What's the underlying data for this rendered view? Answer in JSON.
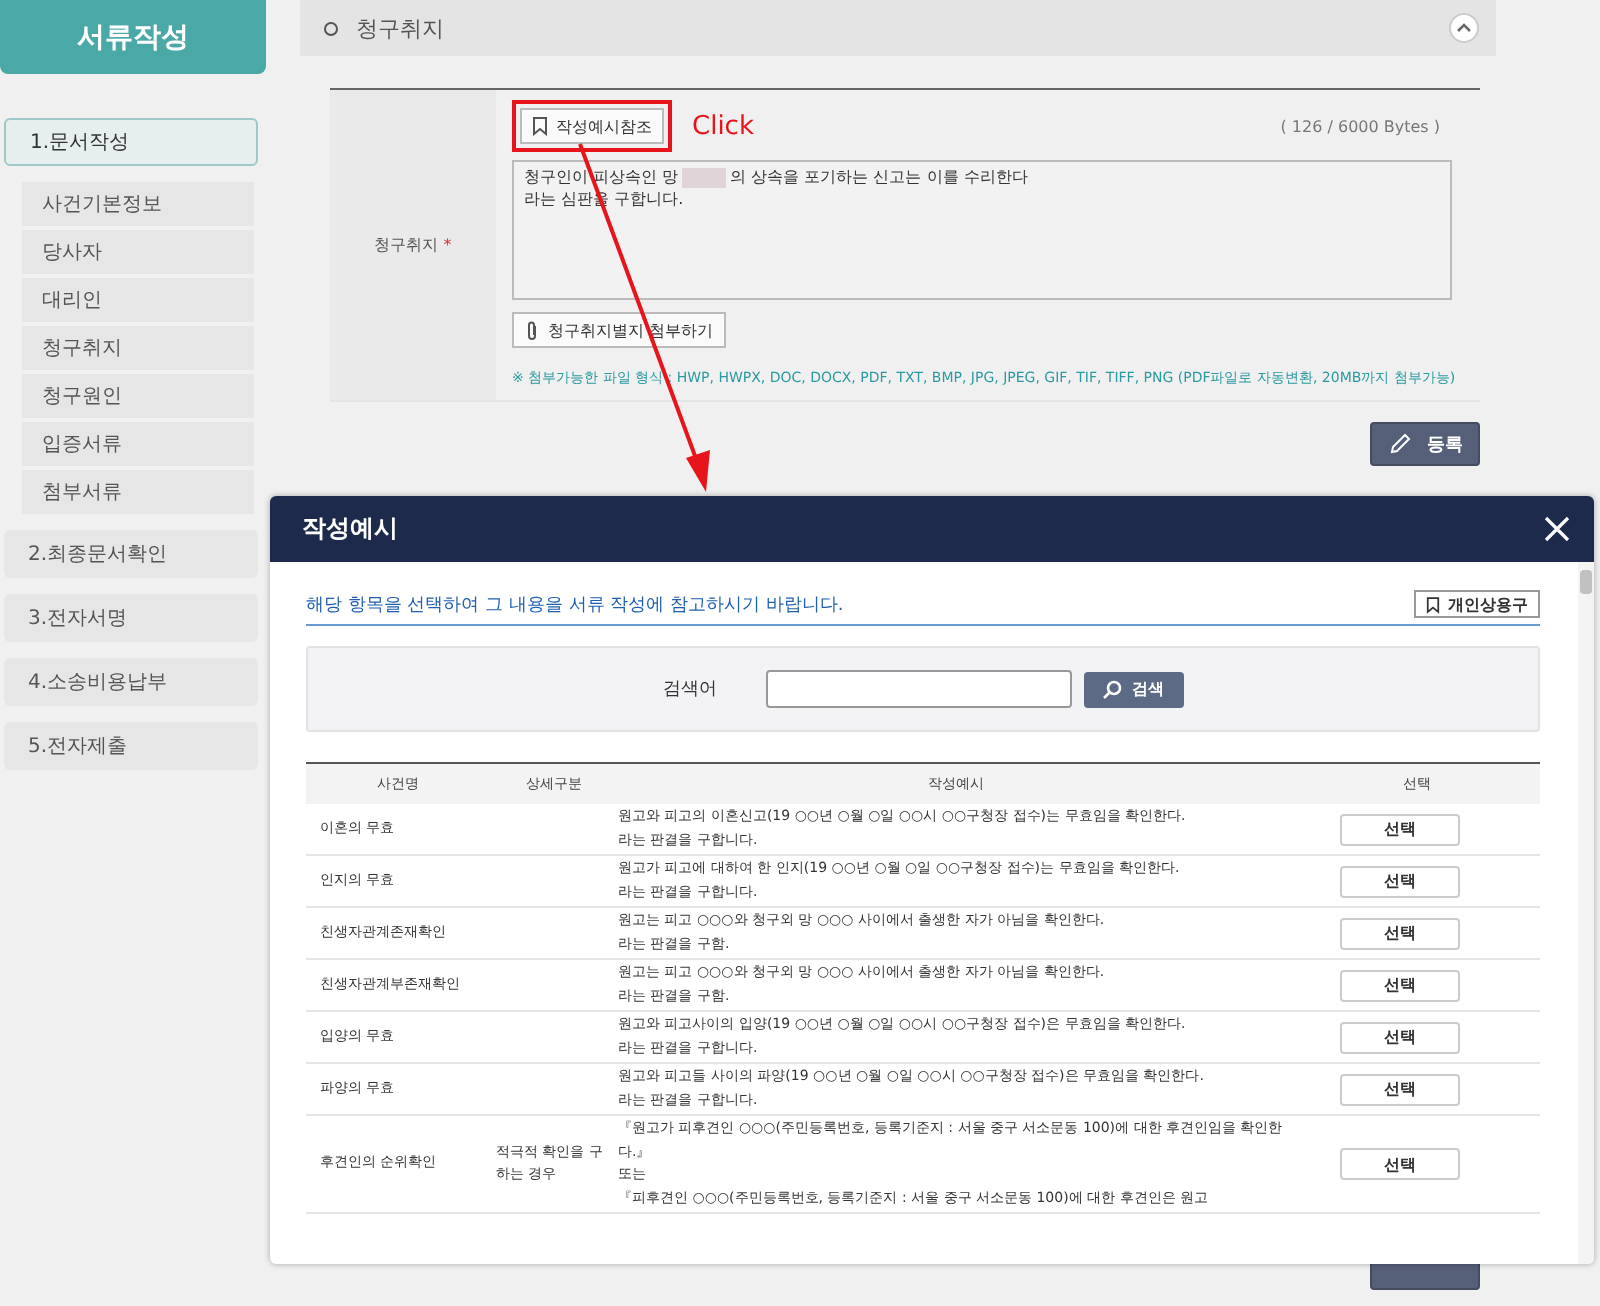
{
  "sidebar": {
    "title": "서류작성",
    "steps": [
      {
        "label": "1.문서작성",
        "selected": true,
        "children": [
          {
            "label": "사건기본정보"
          },
          {
            "label": "당사자"
          },
          {
            "label": "대리인"
          },
          {
            "label": "청구취지"
          },
          {
            "label": "청구원인"
          },
          {
            "label": "입증서류"
          },
          {
            "label": "첨부서류"
          }
        ]
      },
      {
        "label": "2.최종문서확인",
        "selected": false
      },
      {
        "label": "3.전자서명",
        "selected": false
      },
      {
        "label": "4.소송비용납부",
        "selected": false
      },
      {
        "label": "5.전자제출",
        "selected": false
      }
    ]
  },
  "section": {
    "title": "청구취지"
  },
  "form": {
    "label": "청구취지",
    "required_mark": "*",
    "example_button": "작성예시참조",
    "annotation": "Click",
    "byte_count": "( 126 / 6000 Bytes )",
    "text": {
      "before_redaction": "청구인이 피상속인 망",
      "after_redaction": "의 상속을 포기하는 신고는 이를 수리한다",
      "line_2": "라는 심판을 구합니다."
    },
    "attach_button": "청구취지별지 첨부하기",
    "file_note": "※ 첨부가능한 파일 형식 : HWP, HWPX, DOC, DOCX, PDF, TXT, BMP, JPG, JPEG, GIF, TIF, TIFF, PNG (PDF파일로 자동변환, 20MB까지 첨부가능)"
  },
  "register_button": "등록",
  "modal": {
    "title": "작성예시",
    "notice": "해당 항목을 선택하여 그 내용을 서류 작성에 참고하시기 바랍니다.",
    "phrase_button": "개인상용구",
    "search_label": "검색어",
    "search_button": "검색",
    "columns": [
      "사건명",
      "상세구분",
      "작성예시",
      "선택"
    ],
    "rows": [
      {
        "name": "이혼의 무효",
        "example_lines": [
          "원고와 피고의 이혼신고(19 ○○년 ○월 ○일 ○○시 ○○구청장 접수)는 무효임을 확인한다.",
          "라는 판결을 구합니다."
        ],
        "button": "선택"
      },
      {
        "name": "인지의 무효",
        "example_lines": [
          "원고가 피고에 대하여 한 인지(19 ○○년 ○월 ○일 ○○구청장 접수)는 무효임을 확인한다.",
          "라는 판결을 구합니다."
        ],
        "button": "선택"
      },
      {
        "name": "친생자관계존재확인",
        "example_lines": [
          "원고는 피고 ○○○와 청구외 망 ○○○ 사이에서 출생한 자가 아님을 확인한다.",
          "라는 판결을 구함."
        ],
        "button": "선택"
      },
      {
        "name": "친생자관계부존재확인",
        "example_lines": [
          "원고는 피고 ○○○와 청구외 망 ○○○ 사이에서 출생한 자가 아님을 확인한다.",
          "라는 판결을 구함."
        ],
        "button": "선택"
      },
      {
        "name": "입양의 무효",
        "example_lines": [
          "원고와 피고사이의 입양(19 ○○년 ○월 ○일 ○○시 ○○구청장 접수)은 무효임을 확인한다.",
          "라는 판결을 구합니다."
        ],
        "button": "선택"
      },
      {
        "name": "파양의 무효",
        "example_lines": [
          "원고와 피고들 사이의 파양(19 ○○년 ○월 ○일 ○○시 ○○구청장 접수)은 무효임을 확인한다.",
          "라는 판결을 구합니다."
        ],
        "button": "선택"
      },
      {
        "name": "후견인의 순위확인",
        "detail": "적극적 확인을 구하는 경우",
        "example_lines": [
          "『원고가 피후견인 ○○○(주민등록번호, 등록기준지 : 서울 중구 서소문동 100)에 대한 후견인임을 확인한다.』",
          "또는",
          "『피후견인 ○○○(주민등록번호, 등록기준지 : 서울 중구 서소문동 100)에 대한 후견인은 원고"
        ],
        "button": "선택"
      }
    ]
  }
}
